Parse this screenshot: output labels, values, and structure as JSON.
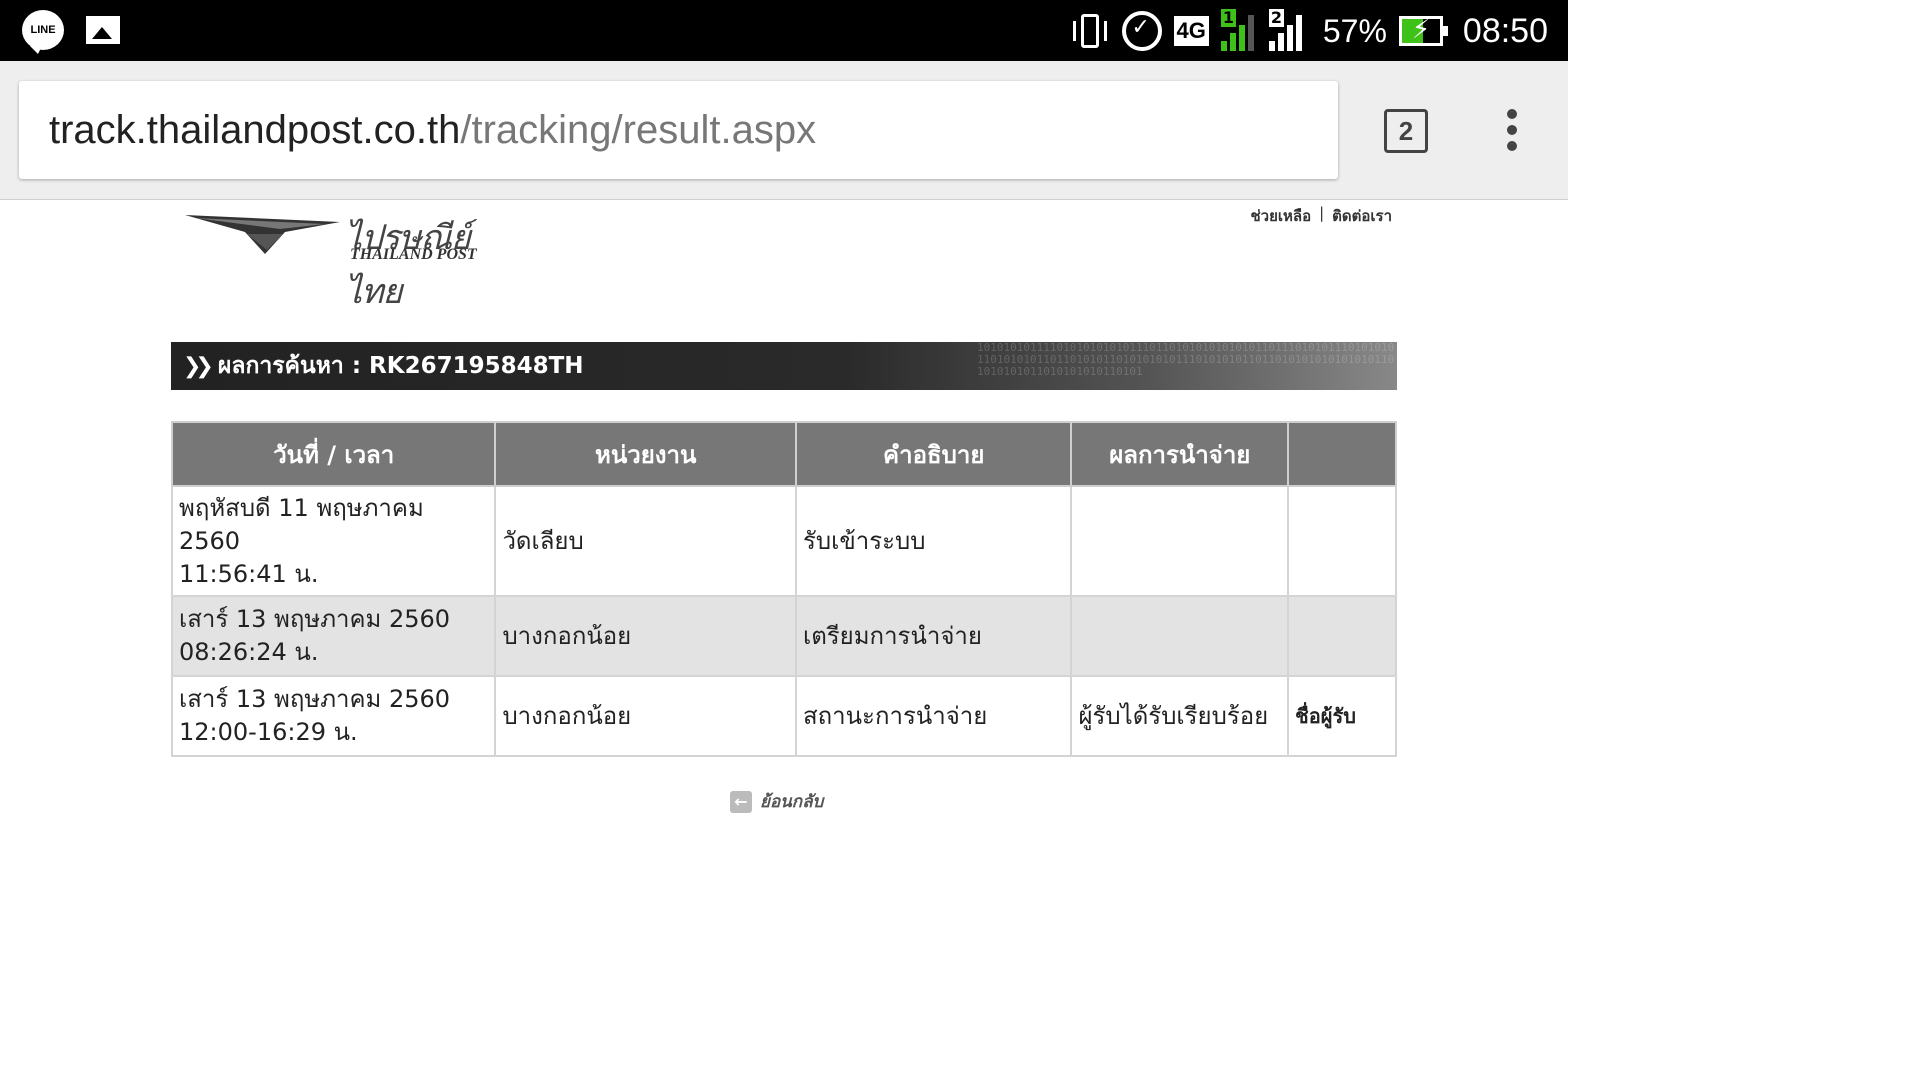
{
  "status_bar": {
    "net_type": "4G",
    "sim1": "1",
    "sim2": "2",
    "battery": "57%",
    "time": "08:50",
    "line_label": "LINE"
  },
  "browser": {
    "url_host": "track.thailandpost.co.th",
    "url_path": "/tracking/result.aspx",
    "tab_count": "2"
  },
  "header": {
    "logo_th": "ไปรษณีย์ไทย",
    "logo_en": "THAILAND POST",
    "help_link": "ช่วยเหลือ",
    "separator": "|",
    "contact_link": "ติดต่อเรา"
  },
  "result": {
    "title": "ผลการค้นหา : RK267195848TH",
    "binary_decor": "1010101011110101010101011101101010101010101101110101011101010101101010101101101010110101010101110101010110110101010101010101101010101011010101010110101"
  },
  "table": {
    "headers": [
      "วันที่ / เวลา",
      "หน่วยงาน",
      "คำอธิบาย",
      "ผลการนำจ่าย",
      ""
    ],
    "rows": [
      {
        "date": "พฤหัสบดี 11 พฤษภาคม 2560",
        "time": "11:56:41 น.",
        "office": "วัดเลียบ",
        "desc": "รับเข้าระบบ",
        "result": "",
        "extra": ""
      },
      {
        "date": "เสาร์ 13 พฤษภาคม 2560",
        "time": "08:26:24 น.",
        "office": "บางกอกน้อย",
        "desc": "เตรียมการนำจ่าย",
        "result": "",
        "extra": ""
      },
      {
        "date": "เสาร์ 13 พฤษภาคม 2560",
        "time": "12:00-16:29 น.",
        "office": "บางกอกน้อย",
        "desc": "สถานะการนำจ่าย",
        "result": "ผู้รับได้รับเรียบร้อย",
        "extra": "ชื่อผู้รับ"
      }
    ]
  },
  "back": {
    "label": "ย้อนกลับ"
  },
  "icons": {
    "line": "line-icon",
    "gallery": "image-icon",
    "vibrate": "vibrate-icon",
    "alarm": "alarm-icon",
    "battery": "battery-icon",
    "tabs": "tab-switcher-icon",
    "menu": "overflow-menu-icon",
    "back": "back-arrow-icon"
  },
  "colors": {
    "accent_green": "#3ec21a",
    "table_header": "#777777",
    "alt_row": "#e3e3e3"
  }
}
